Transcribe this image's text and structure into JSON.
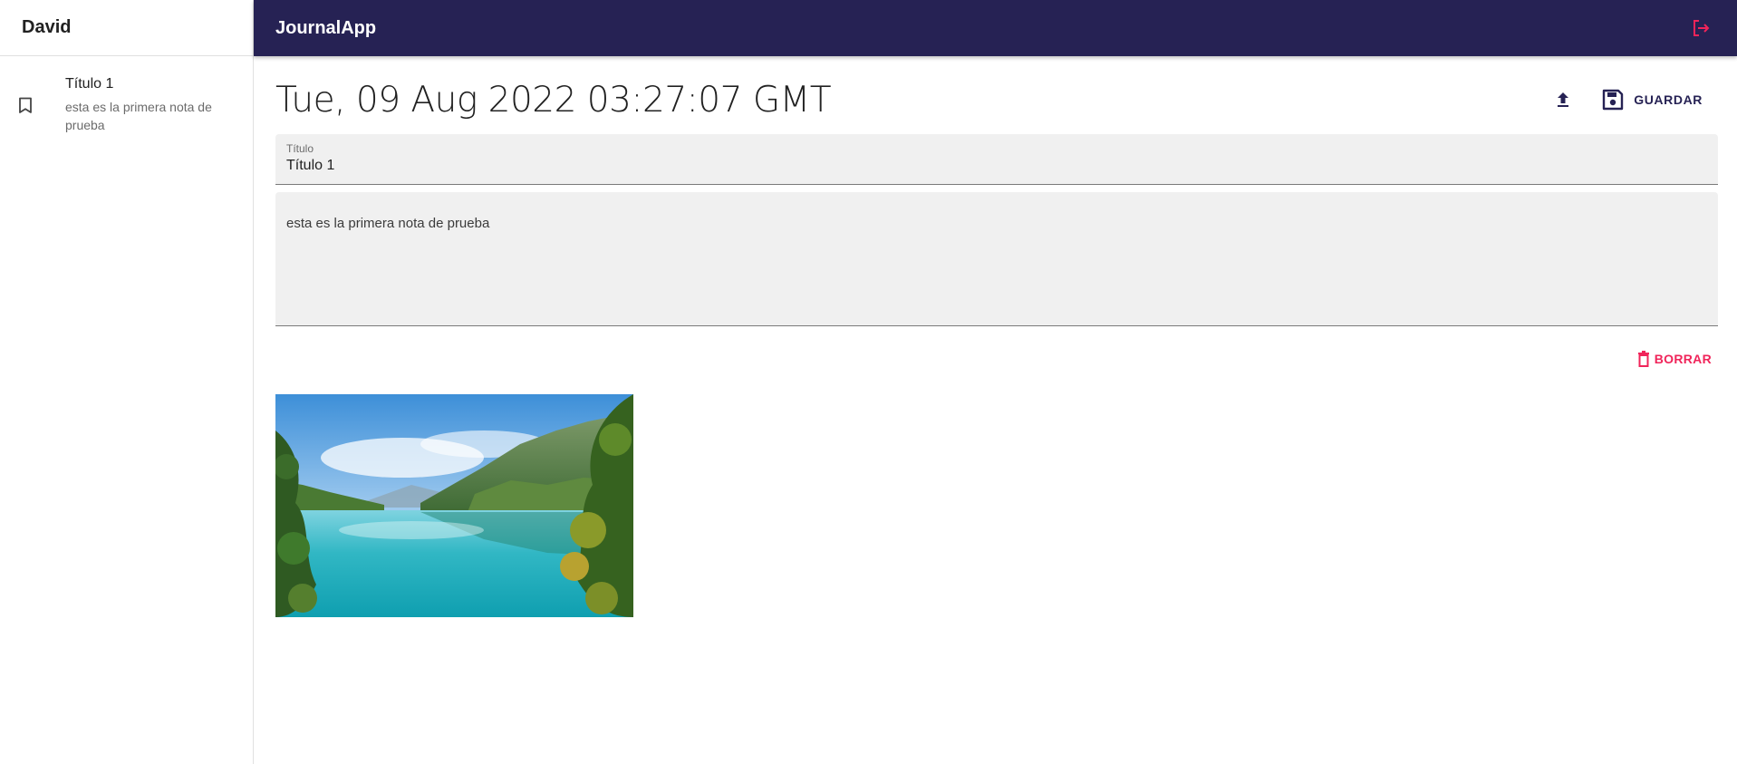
{
  "sidebar": {
    "user_name": "David",
    "notes": [
      {
        "title": "Título 1",
        "body": "esta es la primera nota de prueba"
      }
    ]
  },
  "appbar": {
    "title": "JournalApp"
  },
  "note": {
    "date": "Tue, 09 Aug 2022 03:27:07 GMT",
    "save_label": "GUARDAR",
    "title_label": "Título",
    "title_value": "Título 1",
    "body_value": "esta es la primera nota de prueba",
    "delete_label": "BORRAR"
  },
  "colors": {
    "appbar_bg": "#262254",
    "accent_red": "#f0245a",
    "field_bg": "#f0f0f0"
  },
  "icons": {
    "note": "bookmark-icon",
    "logout": "logout-icon",
    "upload": "upload-icon",
    "save": "save-icon",
    "delete": "trash-icon"
  }
}
